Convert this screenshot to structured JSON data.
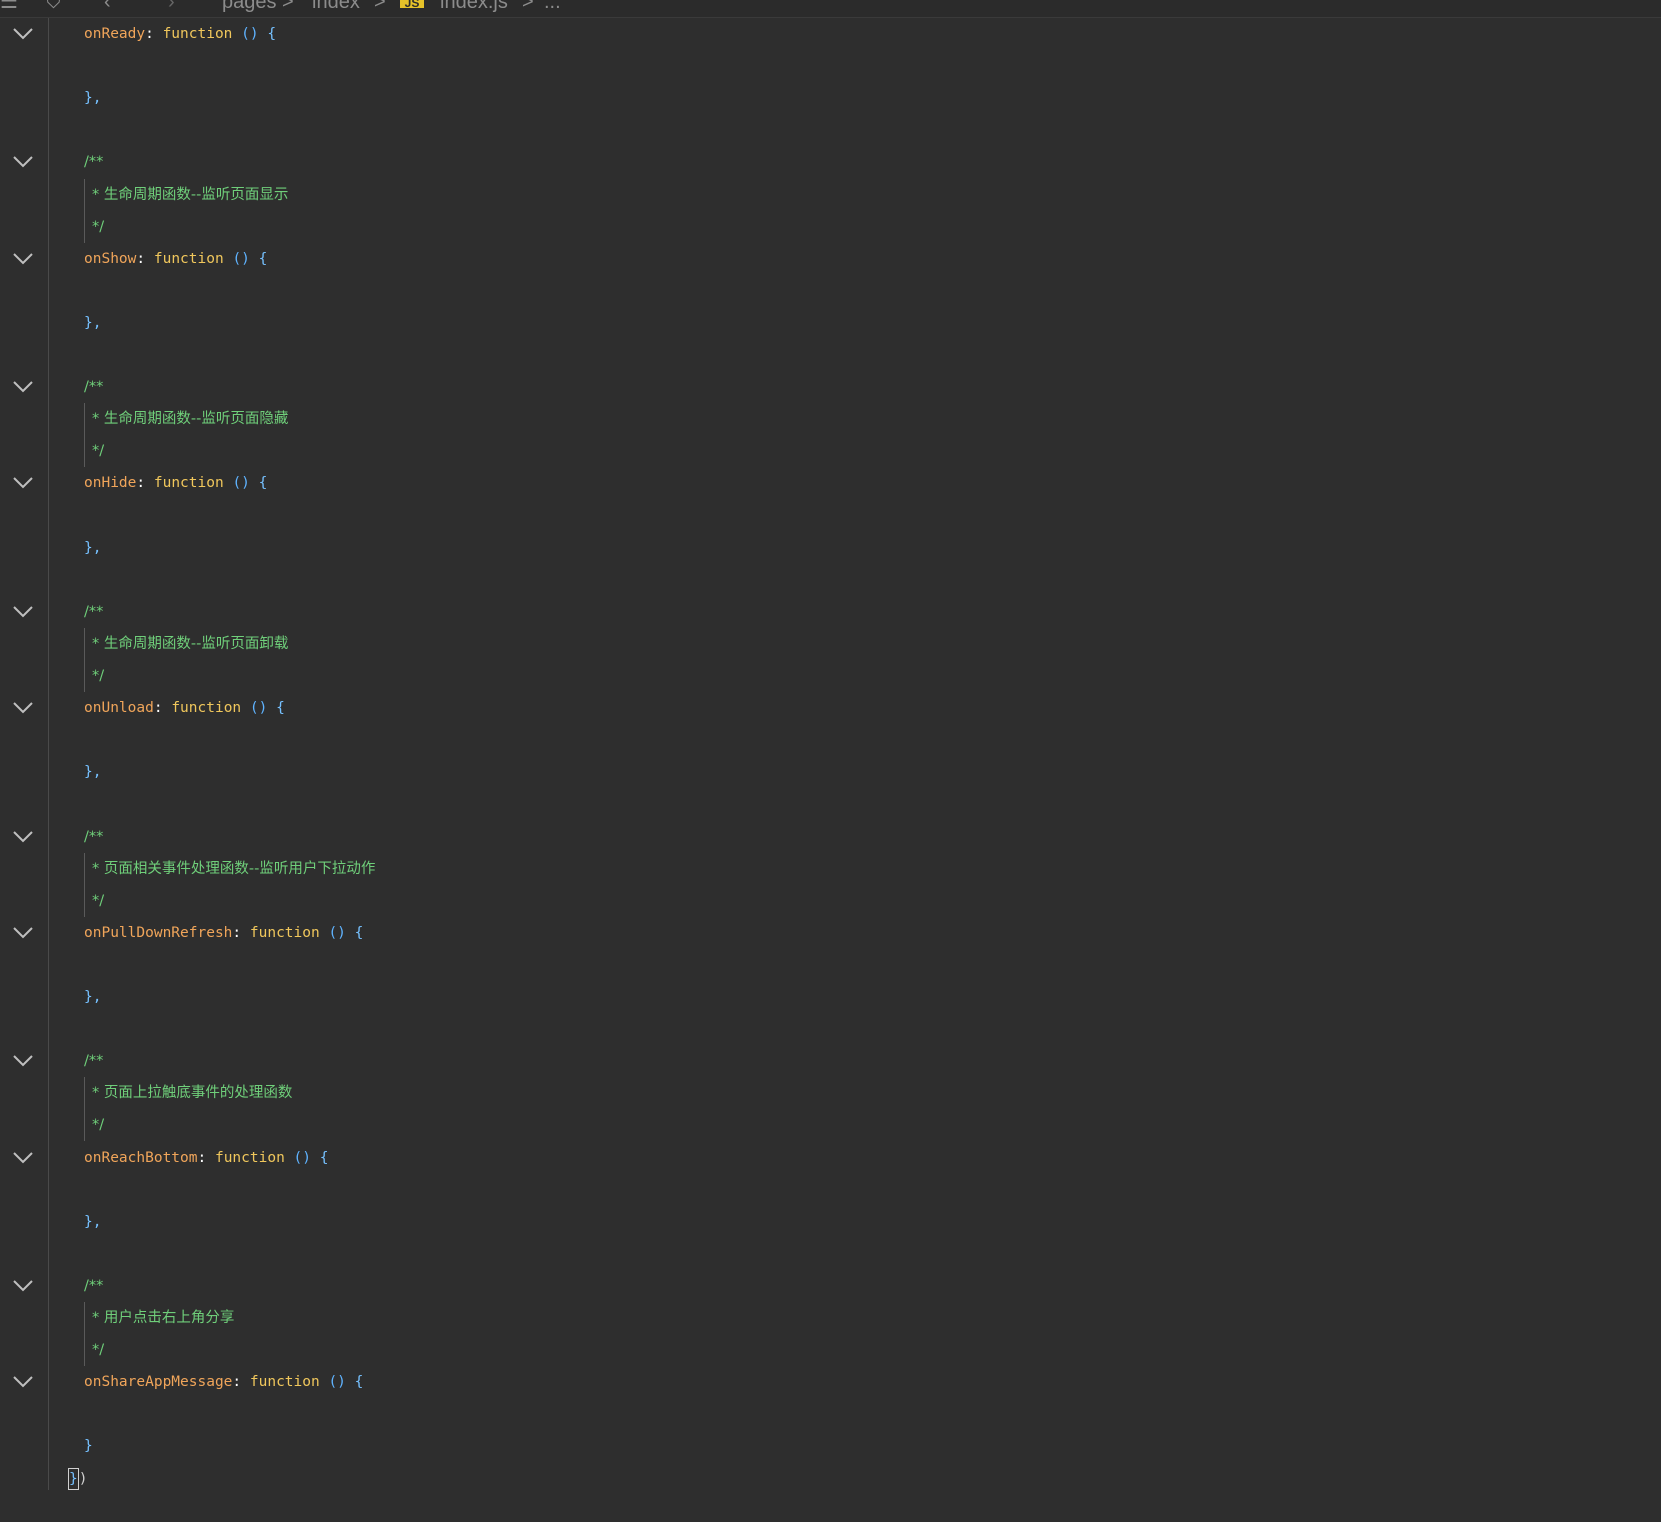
{
  "breadcrumb": {
    "menu_icon": "menu-icon",
    "bookmark_icon": "bookmark-icon",
    "back_icon": "back-icon",
    "forward_icon": "forward-icon",
    "seg1": "pages",
    "sep": ">",
    "seg2": "index",
    "file_badge": "JS",
    "file_name": "index.js",
    "ellipsis": "..."
  },
  "code": {
    "keyword_function": "function",
    "parens": "()",
    "open_brace": "{",
    "close_comma": "},",
    "close_brace": "}",
    "doc_open": "/**",
    "doc_close": "*/",
    "doc_star": "*",
    "final_bracket": "}",
    "final_paren": ")",
    "blocks": [
      {
        "name": "onReady",
        "comment": ""
      },
      {
        "name": "onShow",
        "comment": "生命周期函数--监听页面显示"
      },
      {
        "name": "onHide",
        "comment": "生命周期函数--监听页面隐藏"
      },
      {
        "name": "onUnload",
        "comment": "生命周期函数--监听页面卸载"
      },
      {
        "name": "onPullDownRefresh",
        "comment": "页面相关事件处理函数--监听用户下拉动作"
      },
      {
        "name": "onReachBottom",
        "comment": "页面上拉触底事件的处理函数"
      },
      {
        "name": "onShareAppMessage",
        "comment": "用户点击右上角分享"
      }
    ]
  },
  "colors": {
    "background": "#2e2e2e",
    "property": "#f0a55a",
    "keyword": "#f0c75c",
    "brace": "#76c1ff",
    "comment": "#6fcf7a"
  }
}
